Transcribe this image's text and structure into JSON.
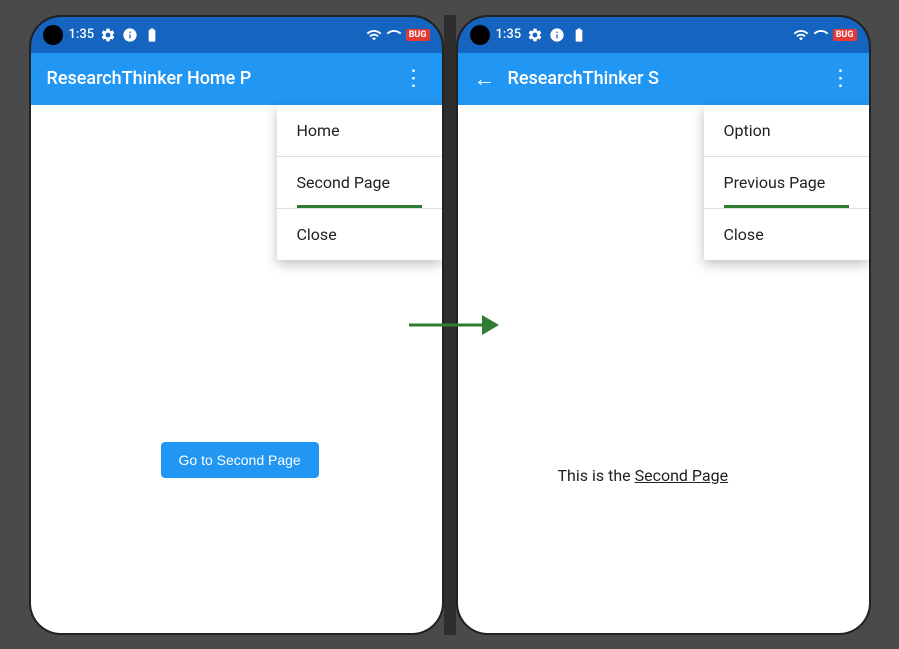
{
  "screen1": {
    "statusBar": {
      "time": "1:35",
      "debugLabel": "BUG"
    },
    "appBar": {
      "title": "ResearchThinker Home P",
      "menuIcon": "⋮"
    },
    "dropdown": {
      "items": [
        {
          "label": "Home",
          "active": false
        },
        {
          "label": "Second Page",
          "active": true
        },
        {
          "label": "Close",
          "active": false
        }
      ]
    },
    "button": {
      "label": "Go to Second Page"
    }
  },
  "screen2": {
    "statusBar": {
      "time": "1:35",
      "debugLabel": "BUG"
    },
    "appBar": {
      "title": "ResearchThinker S",
      "backIcon": "←",
      "menuIcon": "⋮"
    },
    "dropdown": {
      "header": "Option",
      "items": [
        {
          "label": "Previous Page",
          "active": true
        },
        {
          "label": "Close",
          "active": false
        }
      ]
    },
    "bodyText": "This is the",
    "bodyLink": "Second Page"
  },
  "arrow": {
    "color": "#2e7d32"
  }
}
